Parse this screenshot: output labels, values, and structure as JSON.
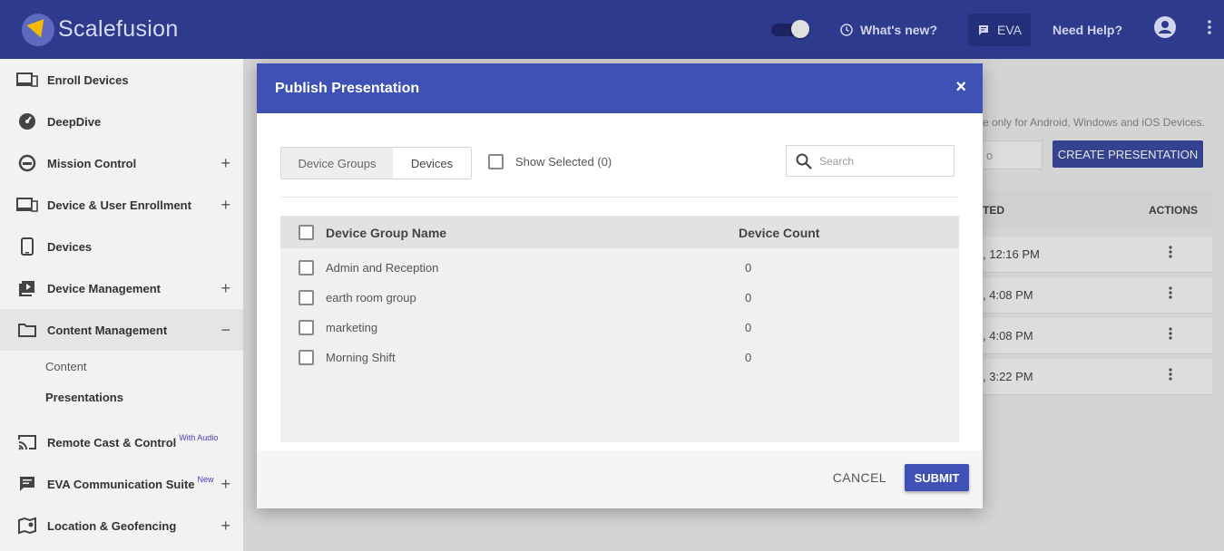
{
  "header": {
    "brand": "Scalefusion",
    "whats_new": "What's new?",
    "eva": "EVA",
    "need_help": "Need Help?"
  },
  "sidebar": {
    "items": [
      {
        "label": "Enroll Devices",
        "icon": "enroll-devices-icon",
        "expand": ""
      },
      {
        "label": "DeepDive",
        "icon": "gauge-icon",
        "expand": ""
      },
      {
        "label": "Mission Control",
        "icon": "mission-control-icon",
        "expand": "+"
      },
      {
        "label": "Device & User Enrollment",
        "icon": "devices-icon",
        "expand": "+"
      },
      {
        "label": "Devices",
        "icon": "phone-icon",
        "expand": ""
      },
      {
        "label": "Device Management",
        "icon": "device-management-icon",
        "expand": "+"
      },
      {
        "label": "Content Management",
        "icon": "folder-icon",
        "expand": "−"
      }
    ],
    "sub_items": [
      "Content",
      "Presentations"
    ],
    "items_after": [
      {
        "label": "Remote Cast & Control",
        "badge": "With Audio",
        "icon": "cast-icon",
        "expand": ""
      },
      {
        "label": "EVA Communication Suite",
        "badge": "New",
        "icon": "chat-icon",
        "expand": "+"
      },
      {
        "label": "Location & Geofencing",
        "badge": "",
        "icon": "map-icon",
        "expand": "+"
      }
    ]
  },
  "background": {
    "note": "e only for Android, Windows and iOS Devices.",
    "input_text": "o",
    "create_button": "CREATE PRESENTATION",
    "col_updated": "TED",
    "col_actions": "ACTIONS",
    "rows": [
      ", 12:16 PM",
      ", 4:08 PM",
      ", 4:08 PM",
      ", 3:22 PM"
    ]
  },
  "modal": {
    "title": "Publish Presentation",
    "close": "×",
    "tabs": [
      "Device Groups",
      "Devices"
    ],
    "show_selected": "Show Selected (0)",
    "search_placeholder": "Search",
    "columns": {
      "name": "Device Group Name",
      "count": "Device Count"
    },
    "rows": [
      {
        "name": "Admin and Reception",
        "count": "0"
      },
      {
        "name": "earth room group",
        "count": "0"
      },
      {
        "name": "marketing",
        "count": "0"
      },
      {
        "name": "Morning Shift",
        "count": "0"
      }
    ],
    "cancel": "CANCEL",
    "submit": "SUBMIT"
  },
  "colors": {
    "topbar": "#2e3a8c",
    "accent": "#3f51b5",
    "badge": "#4a3bb8"
  }
}
